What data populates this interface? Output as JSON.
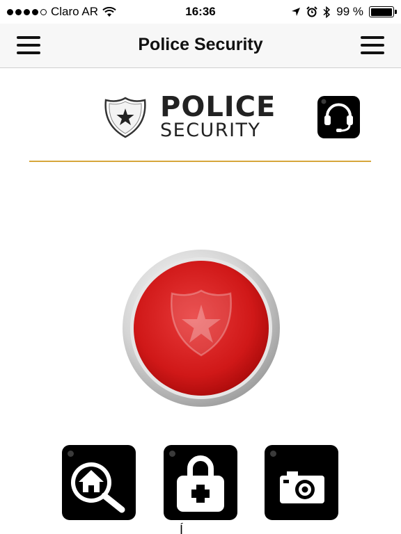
{
  "status_bar": {
    "carrier": "Claro AR",
    "time": "16:36",
    "battery_text": "99 %",
    "battery_level": 0.99,
    "signal_bars": 4,
    "icons": [
      "wifi-icon",
      "location-arrow-icon",
      "alarm-icon",
      "bluetooth-icon",
      "battery-icon"
    ]
  },
  "nav": {
    "title": "Police Security",
    "left_icon": "hamburger-menu-icon",
    "right_icon": "hamburger-menu-icon"
  },
  "header": {
    "logo_line1": "POLICE",
    "logo_line2": "SECURITY",
    "support_icon": "headset-icon"
  },
  "panic_button": {
    "icon": "shield-star-icon",
    "color": "#d01818"
  },
  "quick_actions": [
    {
      "icon": "home-search-icon"
    },
    {
      "icon": "medical-kit-icon"
    },
    {
      "icon": "camera-icon"
    }
  ],
  "bottom_partial_text": "Í",
  "colors": {
    "divider": "#d6a63a",
    "panic_red": "#d01818",
    "icon_bg": "#000000"
  }
}
